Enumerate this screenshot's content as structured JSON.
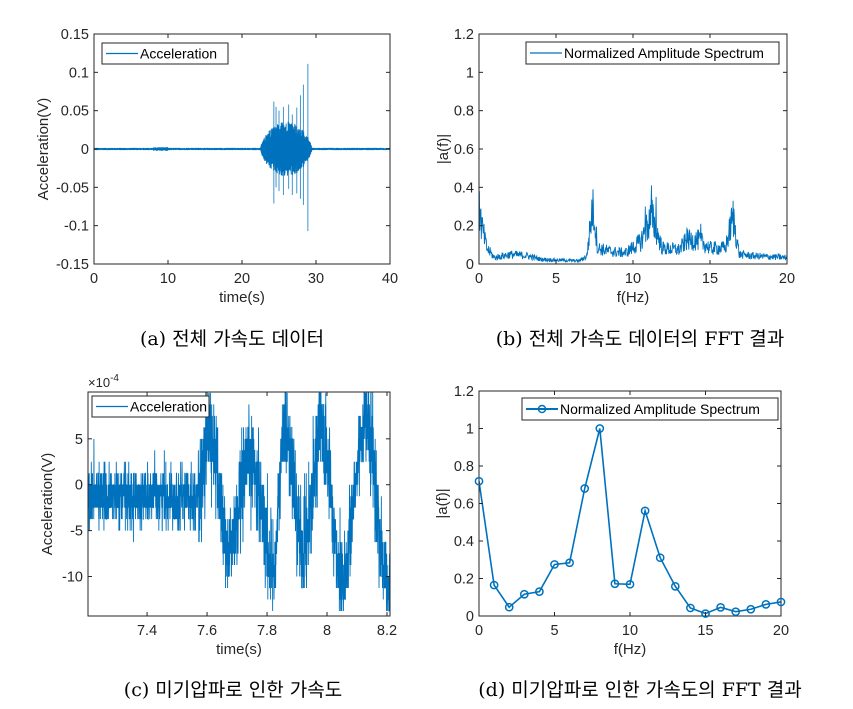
{
  "figure": {
    "line_color": "#0072BD",
    "axis_color": "#262626"
  },
  "chart_data": [
    {
      "id": "a",
      "type": "line",
      "caption": "(a) 전체 가속도 데이터",
      "xlabel": "time(s)",
      "ylabel": "Acceleration(V)",
      "xlim": [
        0,
        40
      ],
      "ylim": [
        -0.15,
        0.15
      ],
      "xticks": [
        0,
        10,
        20,
        30,
        40
      ],
      "xtick_labels": [
        "0",
        "10",
        "20",
        "30",
        "40"
      ],
      "yticks": [
        -0.15,
        -0.1,
        -0.05,
        0,
        0.05,
        0.1,
        0.15
      ],
      "ytick_labels": [
        "-0.15",
        "-0.1",
        "-0.05",
        "0",
        "0.05",
        "0.1",
        "0.15"
      ],
      "grid": false,
      "legend": {
        "entries": [
          "Acceleration"
        ],
        "position": "top-left"
      },
      "series": [
        {
          "name": "Acceleration",
          "description": "Near-zero baseline with burst of vibration between ~23 s and ~30 s",
          "baseline_noise": 0.0015,
          "burst": {
            "start": 22.5,
            "end": 30.5,
            "typical_amplitude": 0.03
          },
          "spikes": [
            {
              "t": 24.3,
              "max": 0.062,
              "min": -0.071
            },
            {
              "t": 24.6,
              "max": 0.055,
              "min": -0.05
            },
            {
              "t": 25.0,
              "max": 0.05,
              "min": -0.055
            },
            {
              "t": 25.6,
              "max": 0.055,
              "min": -0.06
            },
            {
              "t": 26.3,
              "max": 0.058,
              "min": -0.052
            },
            {
              "t": 26.8,
              "max": 0.045,
              "min": -0.06
            },
            {
              "t": 27.4,
              "max": 0.054,
              "min": -0.058
            },
            {
              "t": 27.9,
              "max": 0.07,
              "min": -0.065
            },
            {
              "t": 28.3,
              "max": 0.084,
              "min": -0.073
            },
            {
              "t": 28.9,
              "max": 0.111,
              "min": -0.107
            }
          ]
        }
      ]
    },
    {
      "id": "b",
      "type": "line",
      "caption": "(b) 전체 가속도 데이터의 FFT 결과",
      "xlabel": "f(Hz)",
      "ylabel": "|a(f)|",
      "xlim": [
        0,
        20
      ],
      "ylim": [
        0,
        1.2
      ],
      "xticks": [
        0,
        5,
        10,
        15,
        20
      ],
      "xtick_labels": [
        "0",
        "5",
        "10",
        "15",
        "20"
      ],
      "yticks": [
        0,
        0.2,
        0.4,
        0.6,
        0.8,
        1,
        1.2
      ],
      "ytick_labels": [
        "0",
        "0.2",
        "0.4",
        "0.6",
        "0.8",
        "1",
        "1.2"
      ],
      "grid": false,
      "legend": {
        "entries": [
          "Normalized Amplitude Spectrum"
        ],
        "position": "top-right"
      },
      "series": [
        {
          "name": "Normalized Amplitude Spectrum",
          "description": "Dense amplitude spectrum with peaks near 0, 7.4, 11.2 and 16.5 Hz",
          "envelope": [
            [
              0,
              0.38
            ],
            [
              0.15,
              0.25
            ],
            [
              0.5,
              0.1
            ],
            [
              1.0,
              0.04
            ],
            [
              2.0,
              0.06
            ],
            [
              3.0,
              0.055
            ],
            [
              4.0,
              0.03
            ],
            [
              5.0,
              0.025
            ],
            [
              6.5,
              0.02
            ],
            [
              7.0,
              0.05
            ],
            [
              7.4,
              0.38
            ],
            [
              7.7,
              0.1
            ],
            [
              8.5,
              0.08
            ],
            [
              9.5,
              0.07
            ],
            [
              10.5,
              0.14
            ],
            [
              11.2,
              0.3
            ],
            [
              11.9,
              0.1
            ],
            [
              13.0,
              0.09
            ],
            [
              13.5,
              0.15
            ],
            [
              14.3,
              0.15
            ],
            [
              15.0,
              0.1
            ],
            [
              16.0,
              0.1
            ],
            [
              16.5,
              0.3
            ],
            [
              16.9,
              0.06
            ],
            [
              18.0,
              0.05
            ],
            [
              20.0,
              0.04
            ]
          ],
          "peaks": [
            {
              "f": 0.02,
              "value": 0.38
            },
            {
              "f": 7.4,
              "value": 0.39
            },
            {
              "f": 11.2,
              "value": 0.41
            },
            {
              "f": 11.5,
              "value": 0.35
            },
            {
              "f": 10.8,
              "value": 0.3
            },
            {
              "f": 16.5,
              "value": 0.33
            },
            {
              "f": 14.4,
              "value": 0.21
            },
            {
              "f": 13.5,
              "value": 0.19
            }
          ]
        }
      ]
    },
    {
      "id": "c",
      "type": "line",
      "caption": "(c) 미기압파로 인한 가속도",
      "xlabel": "time(s)",
      "ylabel": "Acceleration(V)",
      "y_exponent_label": "×10",
      "y_exponent": "-4",
      "xlim": [
        7.203,
        8.21
      ],
      "ylim": [
        -14.3,
        10.1
      ],
      "y_scale": 0.0001,
      "xticks": [
        7.4,
        7.6,
        7.8,
        8.0,
        8.2
      ],
      "xtick_labels": [
        "7.4",
        "7.6",
        "7.8",
        "8",
        "8.2"
      ],
      "yticks": [
        -10,
        -5,
        0,
        5
      ],
      "ytick_labels": [
        "-10",
        "-5",
        "0",
        "5"
      ],
      "grid": false,
      "legend": {
        "entries": [
          "Acceleration"
        ],
        "position": "top-left"
      },
      "series": [
        {
          "name": "Acceleration",
          "description": "Quantized noisy signal (step ~1.25e-4) around -1e-4 until ~7.57 s, then oscillation of ~8 Hz with growing amplitude",
          "quantization_step": 1.25,
          "baseline": -1.2,
          "oscillation_start": 7.57,
          "oscillation_hz": 7.9,
          "oscillation_centers": [
            {
              "t": 7.61,
              "value": 5.5
            },
            {
              "t": 7.67,
              "value": -7
            },
            {
              "t": 7.75,
              "value": 2.5
            },
            {
              "t": 7.82,
              "value": -9
            },
            {
              "t": 7.86,
              "value": 6
            },
            {
              "t": 7.92,
              "value": -7
            },
            {
              "t": 7.98,
              "value": 6
            },
            {
              "t": 8.05,
              "value": -10
            },
            {
              "t": 8.13,
              "value": 7
            },
            {
              "t": 8.2,
              "value": -10
            }
          ]
        }
      ]
    },
    {
      "id": "d",
      "type": "line",
      "caption": "(d) 미기압파로 인한 가속도의 FFT 결과",
      "xlabel": "f(Hz)",
      "ylabel": "|a(f)|",
      "xlim": [
        0,
        20
      ],
      "ylim": [
        0,
        1.2
      ],
      "xticks": [
        0,
        5,
        10,
        15,
        20
      ],
      "xtick_labels": [
        "0",
        "5",
        "10",
        "15",
        "20"
      ],
      "yticks": [
        0,
        0.2,
        0.4,
        0.6,
        0.8,
        1,
        1.2
      ],
      "ytick_labels": [
        "0",
        "0.2",
        "0.4",
        "0.6",
        "0.8",
        "1",
        "1.2"
      ],
      "grid": false,
      "marker": "circle",
      "legend": {
        "entries": [
          "Normalized Amplitude Spectrum"
        ],
        "position": "top-right"
      },
      "series": [
        {
          "name": "Normalized Amplitude Spectrum",
          "x": [
            0,
            1,
            2,
            3,
            4,
            5,
            6,
            7,
            8,
            9,
            10,
            11,
            12,
            13,
            14,
            15,
            16,
            17,
            18,
            19,
            20
          ],
          "y": [
            0.719,
            0.165,
            0.047,
            0.116,
            0.13,
            0.275,
            0.284,
            0.68,
            1.0,
            0.172,
            0.169,
            0.561,
            0.311,
            0.158,
            0.043,
            0.013,
            0.046,
            0.023,
            0.036,
            0.062,
            0.075
          ]
        }
      ]
    }
  ]
}
